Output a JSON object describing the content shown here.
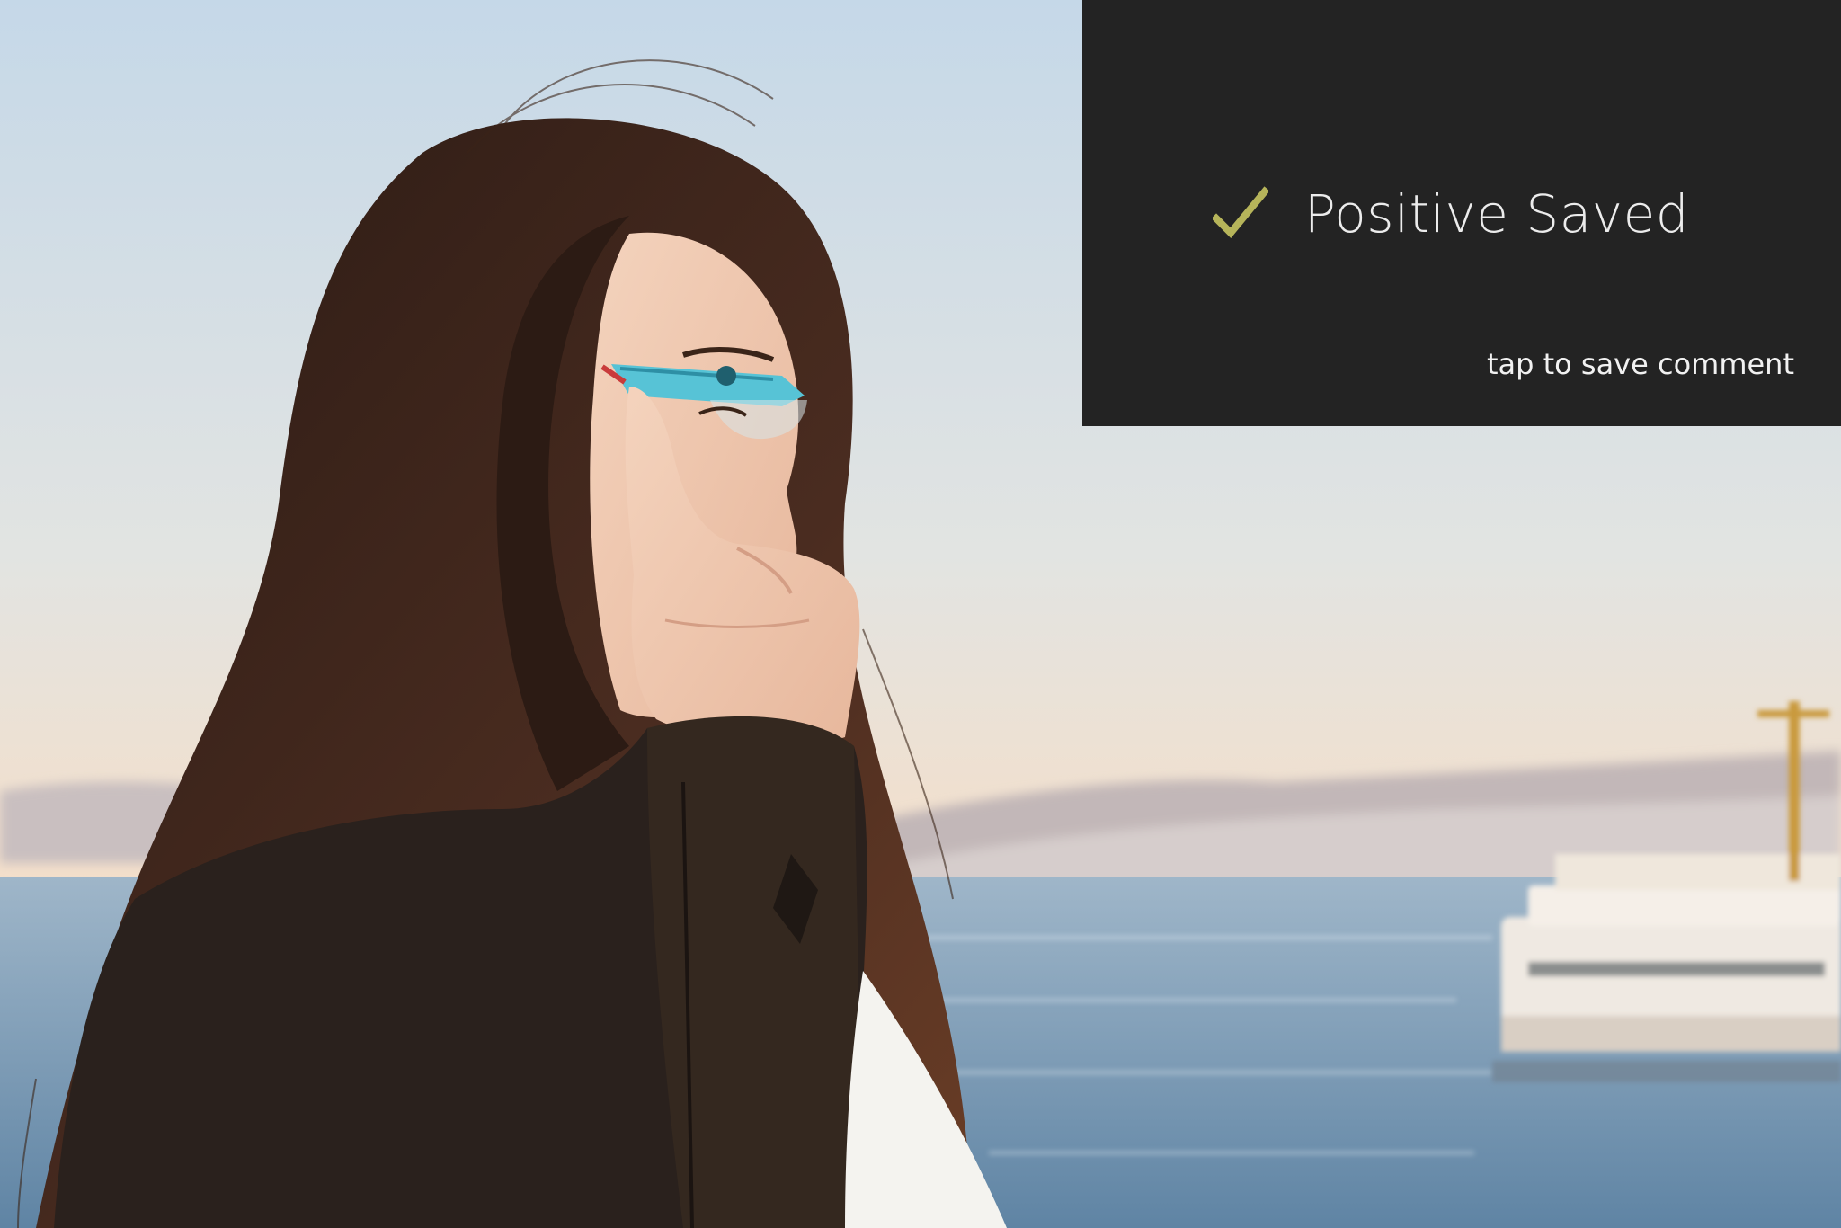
{
  "card": {
    "status_icon": "check-icon",
    "title": "Positive Saved",
    "hint": "tap to save comment",
    "accent_color": "#b6b45a",
    "background_color": "#232323"
  },
  "photo": {
    "subject": "woman-with-head-mounted-display",
    "background": "waterfront-with-ferry"
  }
}
